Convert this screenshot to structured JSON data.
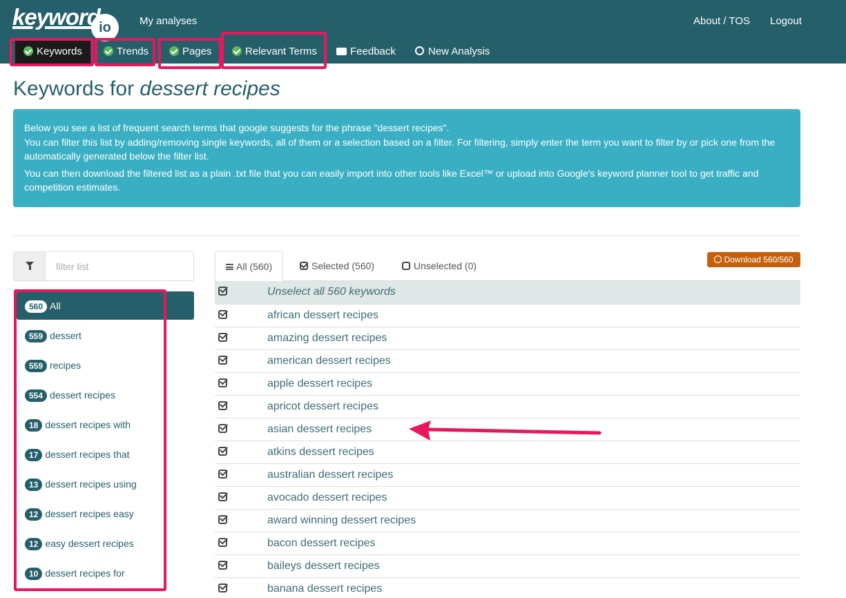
{
  "header": {
    "logo_word": "keyword",
    "logo_suffix": "io",
    "my_analyses": "My analyses",
    "about": "About / TOS",
    "logout": "Logout",
    "tabs": [
      {
        "label": "Keywords"
      },
      {
        "label": "Trends"
      },
      {
        "label": "Pages"
      },
      {
        "label": "Relevant Terms"
      },
      {
        "label": "Feedback"
      },
      {
        "label": "New Analysis"
      }
    ]
  },
  "page": {
    "title_prefix": "Keywords for",
    "title_query": "dessert recipes"
  },
  "info": {
    "line1": "Below you see a list of frequent search terms that google suggests for the phrase \"dessert recipes\".",
    "line2": "You can filter this list by adding/removing single keywords, all of them or a selection based on a filter. For filtering, simply enter the term you want to filter by or pick one from the automatically generated below the filter list.",
    "line3": "You can then download the filtered list as a plain .txt file that you can easily import into other tools like Excel™ or upload into Google's keyword planner tool to get traffic and competition estimates."
  },
  "filter": {
    "placeholder": "filter list"
  },
  "facets": [
    {
      "count": "560",
      "label": "All"
    },
    {
      "count": "559",
      "label": "dessert"
    },
    {
      "count": "559",
      "label": "recipes"
    },
    {
      "count": "554",
      "label": "dessert recipes"
    },
    {
      "count": "18",
      "label": "dessert recipes with"
    },
    {
      "count": "17",
      "label": "dessert recipes that"
    },
    {
      "count": "13",
      "label": "dessert recipes using"
    },
    {
      "count": "12",
      "label": "dessert recipes easy"
    },
    {
      "count": "12",
      "label": "easy dessert recipes"
    },
    {
      "count": "10",
      "label": "dessert recipes for"
    }
  ],
  "list_tabs": {
    "all": "All (560)",
    "selected": "Selected (560)",
    "unselected": "Unselected (0)"
  },
  "download": "Download 560/560",
  "keywords": {
    "header_row": "Unselect all 560 keywords",
    "items": [
      "african dessert recipes",
      "amazing dessert recipes",
      "american dessert recipes",
      "apple dessert recipes",
      "apricot dessert recipes",
      "asian dessert recipes",
      "atkins dessert recipes",
      "australian dessert recipes",
      "avocado dessert recipes",
      "award winning dessert recipes",
      "bacon dessert recipes",
      "baileys dessert recipes",
      "banana dessert recipes"
    ]
  },
  "colors": {
    "header_bg": "#255f6a",
    "info_bg": "#3aafc3",
    "highlight": "#e8175d",
    "download_bg": "#c5610e",
    "check_green": "#5cb85c"
  }
}
